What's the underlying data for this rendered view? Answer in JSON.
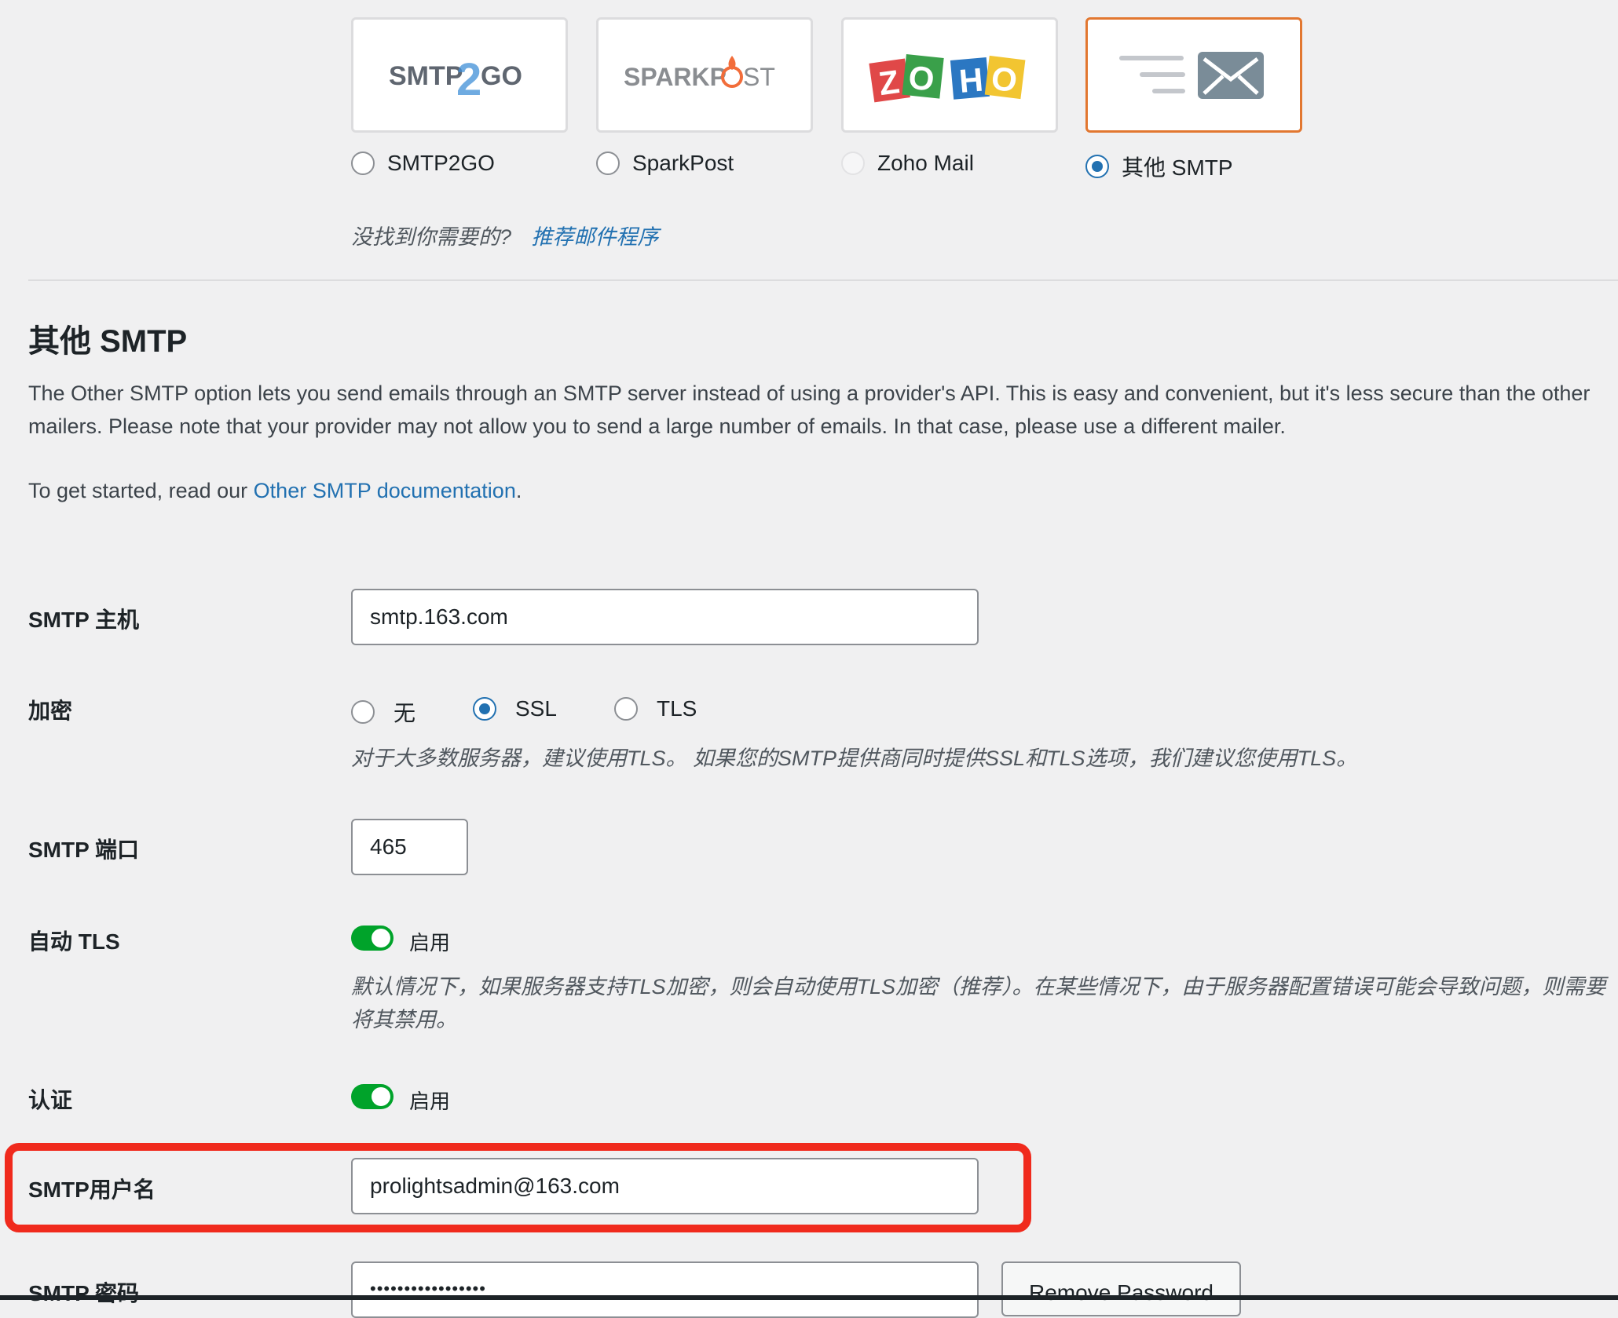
{
  "mailers": [
    {
      "name": "SMTP2GO",
      "logo": "SMTP2GO",
      "state": "unchecked"
    },
    {
      "name": "SparkPost",
      "logo": "SPARKPOST",
      "state": "unchecked"
    },
    {
      "name": "Zoho Mail",
      "logo": "ZOHO",
      "state": "disabled"
    },
    {
      "name": "其他 SMTP",
      "logo": "other-smtp-mail-icon",
      "state": "checked"
    }
  ],
  "mailer_hint": {
    "text": "没找到你需要的?",
    "link": "推荐邮件程序"
  },
  "section": {
    "title": "其他 SMTP",
    "description": "The Other SMTP option lets you send emails through an SMTP server instead of using a provider's API. This is easy and convenient, but it's less secure than the other mailers. Please note that your provider may not allow you to send a large number of emails. In that case, please use a different mailer.",
    "started_prefix": "To get started, read our ",
    "started_link": "Other SMTP documentation",
    "started_suffix": "."
  },
  "fields": {
    "host": {
      "label": "SMTP 主机",
      "value": "smtp.163.com"
    },
    "encryption": {
      "label": "加密",
      "options": [
        {
          "label": "无",
          "state": "unchecked"
        },
        {
          "label": "SSL",
          "state": "checked"
        },
        {
          "label": "TLS",
          "state": "unchecked"
        }
      ],
      "hint": "对于大多数服务器，建议使用TLS。 如果您的SMTP提供商同时提供SSL和TLS选项，我们建议您使用TLS。"
    },
    "port": {
      "label": "SMTP 端口",
      "value": "465"
    },
    "auto_tls": {
      "label": "自动 TLS",
      "toggle_label": "启用",
      "enabled": true,
      "hint": "默认情况下，如果服务器支持TLS加密，则会自动使用TLS加密（推荐）。在某些情况下，由于服务器配置错误可能会导致问题，则需要将其禁用。"
    },
    "auth": {
      "label": "认证",
      "toggle_label": "启用",
      "enabled": true
    },
    "username": {
      "label": "SMTP用户名",
      "value": "prolightsadmin@163.com"
    },
    "password": {
      "label": "SMTP 密码",
      "value": "•••••••••••••••••",
      "remove_label": "Remove Password"
    }
  },
  "colors": {
    "accent": "#2271b1",
    "toggle_on": "#00a32a",
    "selected_tile": "#e27730",
    "highlight": "#f02a1d"
  }
}
